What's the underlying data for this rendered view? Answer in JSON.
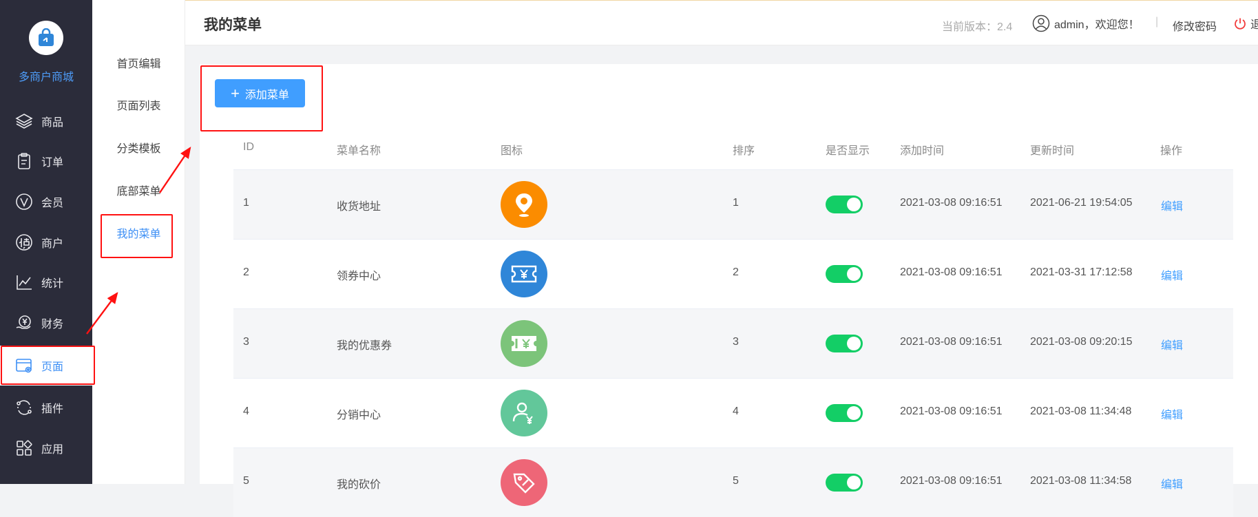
{
  "brand": {
    "name": "多商户商城"
  },
  "sidebar": {
    "items": [
      {
        "label": "商品",
        "icon": "layers-icon"
      },
      {
        "label": "订单",
        "icon": "clipboard-icon"
      },
      {
        "label": "会员",
        "icon": "vip-icon"
      },
      {
        "label": "商户",
        "icon": "supplier-icon"
      },
      {
        "label": "统计",
        "icon": "line-chart-icon"
      },
      {
        "label": "财务",
        "icon": "finance-icon"
      },
      {
        "label": "页面",
        "icon": "page-settings-icon",
        "active": true
      },
      {
        "label": "插件",
        "icon": "plugin-icon"
      },
      {
        "label": "应用",
        "icon": "apps-icon"
      }
    ]
  },
  "submenu": {
    "items": [
      {
        "label": "首页编辑"
      },
      {
        "label": "页面列表"
      },
      {
        "label": "分类模板"
      },
      {
        "label": "底部菜单"
      },
      {
        "label": "我的菜单",
        "active": true
      }
    ]
  },
  "header": {
    "title": "我的菜单",
    "version": "当前版本：2.4",
    "user": "admin，欢迎您！",
    "separator": "|",
    "change_password": "修改密码",
    "logout": "退"
  },
  "toolbar": {
    "add_label": "添加菜单",
    "add_icon": "plus-icon"
  },
  "table": {
    "columns": [
      "ID",
      "菜单名称",
      "图标",
      "排序",
      "是否显示",
      "添加时间",
      "更新时间",
      "操作"
    ],
    "rows": [
      {
        "id": "1",
        "name": "收货地址",
        "icon": "location-pin-icon",
        "icon_color": "#fb8c00",
        "sort": "1",
        "visible": true,
        "created": "2021-03-08 09:16:51",
        "updated": "2021-06-21 19:54:05",
        "action": "编辑"
      },
      {
        "id": "2",
        "name": "领券中心",
        "icon": "coupon-ticket-icon",
        "icon_color": "#2f86d8",
        "sort": "2",
        "visible": true,
        "created": "2021-03-08 09:16:51",
        "updated": "2021-03-31 17:12:58",
        "action": "编辑"
      },
      {
        "id": "3",
        "name": "我的优惠券",
        "icon": "voucher-icon",
        "icon_color": "#7cc47a",
        "sort": "3",
        "visible": true,
        "created": "2021-03-08 09:16:51",
        "updated": "2021-03-08 09:20:15",
        "action": "编辑"
      },
      {
        "id": "4",
        "name": "分销中心",
        "icon": "distributor-icon",
        "icon_color": "#62c79a",
        "sort": "4",
        "visible": true,
        "created": "2021-03-08 09:16:51",
        "updated": "2021-03-08 11:34:48",
        "action": "编辑"
      },
      {
        "id": "5",
        "name": "我的砍价",
        "icon": "bargain-tag-icon",
        "icon_color": "#ee6677",
        "sort": "5",
        "visible": true,
        "created": "2021-03-08 09:16:51",
        "updated": "2021-03-08 11:34:58",
        "action": "编辑"
      }
    ]
  },
  "colors": {
    "accent": "#409eff",
    "sidebar_bg": "#2b2c3a",
    "toggle_on": "#13ce66",
    "highlight": "#ff1111"
  }
}
